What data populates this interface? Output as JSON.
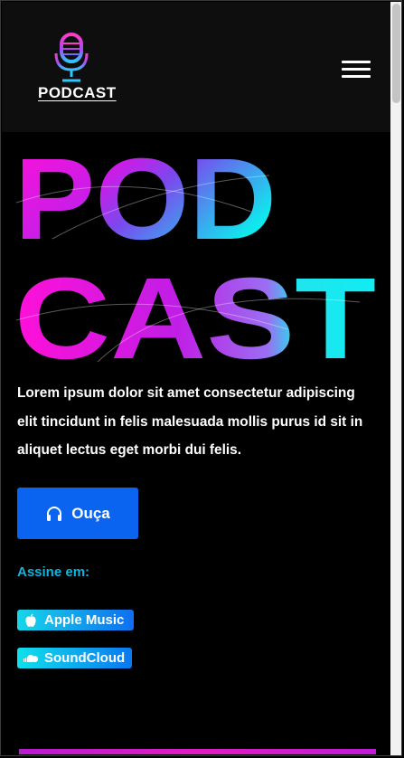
{
  "header": {
    "logo_text": "PODCAST",
    "logo_icon": "microphone-icon",
    "menu_icon": "hamburger-menu-icon"
  },
  "hero": {
    "line1": "POD",
    "line2": "CAST",
    "gradient_start": "#ff10d8",
    "gradient_end": "#10e8ee"
  },
  "description": "Lorem ipsum dolor sit amet consectetur adipiscing elit tincidunt in felis malesuada mollis purus id sit in aliquet lectus eget morbi dui felis.",
  "listen_button": {
    "label": "Ouça",
    "icon": "headphones-icon",
    "color": "#0a64f0"
  },
  "subscribe": {
    "label": "Assine em:",
    "platforms": [
      {
        "label": "Apple Music",
        "icon": "apple-icon"
      },
      {
        "label": "SoundCloud",
        "icon": "soundcloud-icon"
      }
    ]
  },
  "colors": {
    "accent": "#0fb4dc",
    "background": "#000000",
    "header_bg": "#0e0e0e"
  }
}
